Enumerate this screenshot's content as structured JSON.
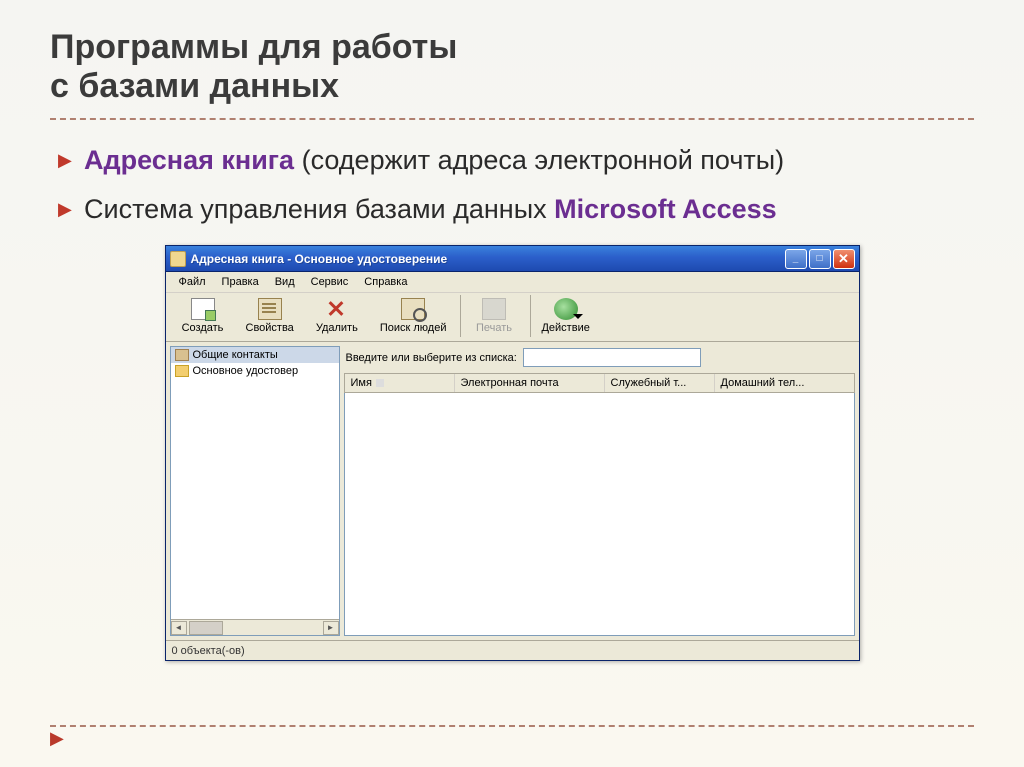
{
  "slide": {
    "title_line1": "Программы для работы",
    "title_line2": "с базами данных",
    "bullets": [
      {
        "highlight": "Адресная книга",
        "rest": " (содержит адреса электронной почты)"
      },
      {
        "prefix": "Система управления базами данных ",
        "highlight": "Microsoft Access"
      }
    ]
  },
  "window": {
    "title": "Адресная книга - Основное удостоверение",
    "menu": [
      "Файл",
      "Правка",
      "Вид",
      "Сервис",
      "Справка"
    ],
    "toolbar": {
      "create": "Создать",
      "props": "Свойства",
      "delete": "Удалить",
      "search": "Поиск людей",
      "print": "Печать",
      "action": "Действие"
    },
    "tree": {
      "item1": "Общие контакты",
      "item2": "Основное удостовер"
    },
    "search_prompt": "Введите или выберите из списка:",
    "columns": {
      "name": "Имя",
      "email": "Электронная почта",
      "work_phone": "Служебный т...",
      "home_phone": "Домашний тел..."
    },
    "status": "0 объекта(-ов)"
  },
  "window_buttons": {
    "min": "_",
    "max": "□",
    "close": "✕"
  }
}
